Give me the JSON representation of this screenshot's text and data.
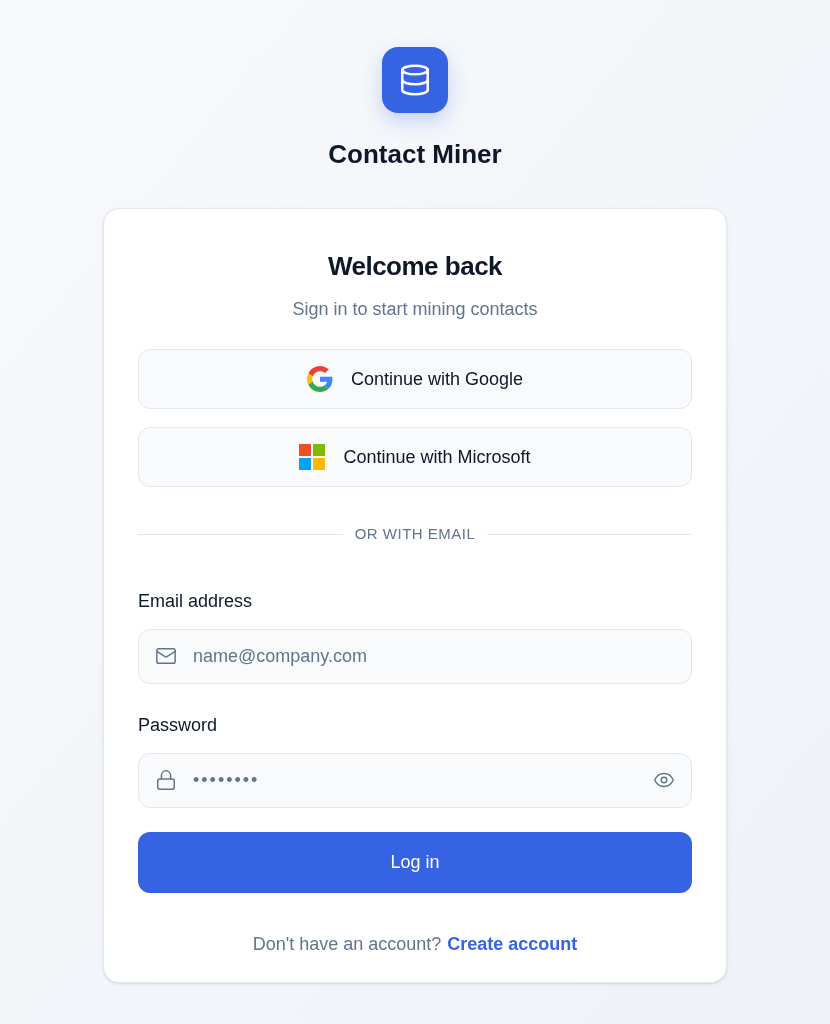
{
  "app": {
    "name": "Contact Miner"
  },
  "card": {
    "title": "Welcome back",
    "subtitle": "Sign in to start mining contacts",
    "providers": [
      {
        "kind": "google",
        "label": "Continue with Google"
      },
      {
        "kind": "microsoft",
        "label": "Continue with Microsoft"
      }
    ],
    "divider": "OR WITH EMAIL",
    "fields": [
      {
        "kind": "email",
        "label": "Email address",
        "placeholder": "name@company.com"
      },
      {
        "kind": "password",
        "label": "Password",
        "value": "••••••••"
      }
    ],
    "submit": "Log in",
    "footer": {
      "text": "Don't have an account?",
      "link": "Create account"
    }
  }
}
